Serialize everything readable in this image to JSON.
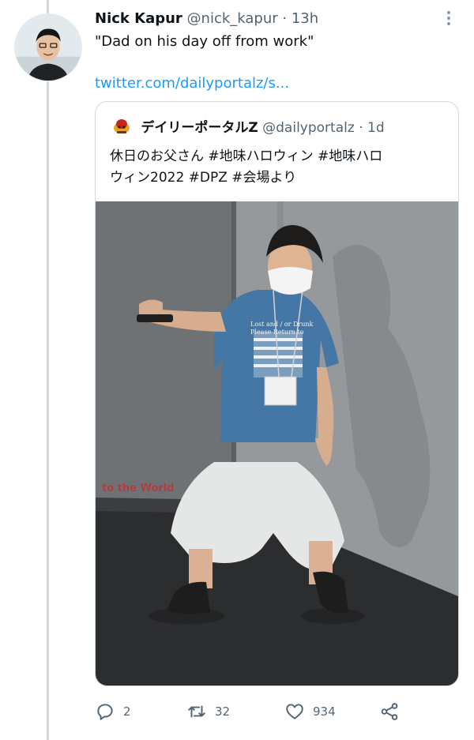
{
  "tweet": {
    "author_name": "Nick Kapur",
    "author_handle": "@nick_kapur",
    "separator": "·",
    "time": "13h",
    "text": "\"Dad on his day off from work\"",
    "link": "twitter.com/dailyportalz/s..."
  },
  "quote": {
    "author_name": "デイリーポータルZ",
    "author_handle": "@dailyportalz",
    "separator": "·",
    "time": "1d",
    "text_line1": "休日のお父さん #地味ハロウィン #地味ハロ",
    "text_line2": "ウィン2022 #DPZ #会場より",
    "photo_shirt_line1": "Lost and / or Drunk",
    "photo_shirt_line2": "Please Return to",
    "photo_wall_text": "to the World"
  },
  "actions": {
    "replies": "2",
    "retweets": "32",
    "likes": "934"
  },
  "colors": {
    "link": "#1d9bf0",
    "text": "#0f1419",
    "muted": "#536471",
    "border": "#cfd9de"
  },
  "icons": {
    "reply": "reply-icon",
    "retweet": "retweet-icon",
    "like": "heart-icon",
    "share": "share-icon",
    "more": "more-icon",
    "quote_avatar": "dpz-logo-icon"
  }
}
